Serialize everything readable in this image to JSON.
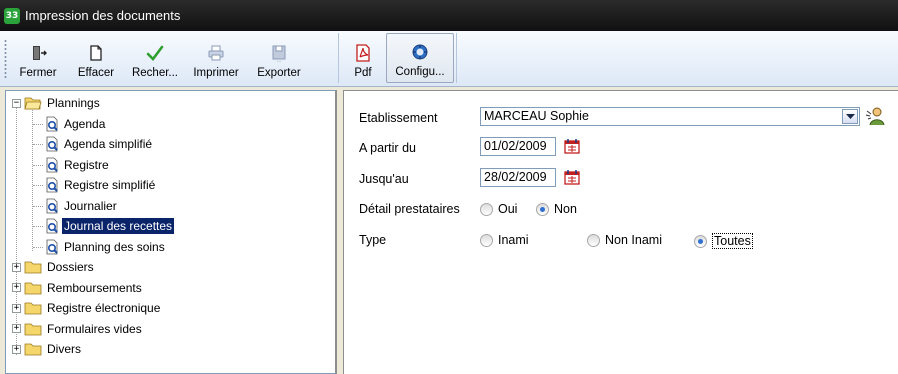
{
  "window": {
    "title": "Impression des documents",
    "icon_text": "33"
  },
  "toolbar": {
    "left": [
      {
        "label": "Fermer",
        "icon": "exit-door-icon"
      },
      {
        "label": "Effacer",
        "icon": "blank-page-icon"
      },
      {
        "label": "Recher...",
        "icon": "checkmark-icon"
      },
      {
        "label": "Imprimer",
        "icon": "printer-icon"
      },
      {
        "label": "Exporter",
        "icon": "floppy-export-icon"
      }
    ],
    "right": [
      {
        "label": "Pdf",
        "icon": "pdf-icon"
      },
      {
        "label": "Configu...",
        "icon": "config-icon"
      }
    ]
  },
  "tree": {
    "root_open": "Plannings",
    "children": [
      "Agenda",
      "Agenda simplifié",
      "Registre",
      "Registre simplifié",
      "Journalier",
      "Journal des recettes",
      "Planning des soins"
    ],
    "selected": "Journal des recettes",
    "closed": [
      "Dossiers",
      "Remboursements",
      "Registre électronique",
      "Formulaires vides",
      "Divers"
    ]
  },
  "form": {
    "etablissement_label": "Etablissement",
    "etablissement_value": "MARCEAU Sophie",
    "from_label": "A partir du",
    "from_value": "01/02/2009",
    "to_label": "Jusqu'au",
    "to_value": "28/02/2009",
    "detail_label": "Détail prestataires",
    "detail_options": [
      "Oui",
      "Non"
    ],
    "detail_selected": "Non",
    "type_label": "Type",
    "type_options": [
      "Inami",
      "Non Inami",
      "Toutes"
    ],
    "type_selected": "Toutes"
  },
  "colors": {
    "selection": "#0a246a",
    "titlebar": "#1a1a1a",
    "radio_dot": "#2f6fd1"
  }
}
